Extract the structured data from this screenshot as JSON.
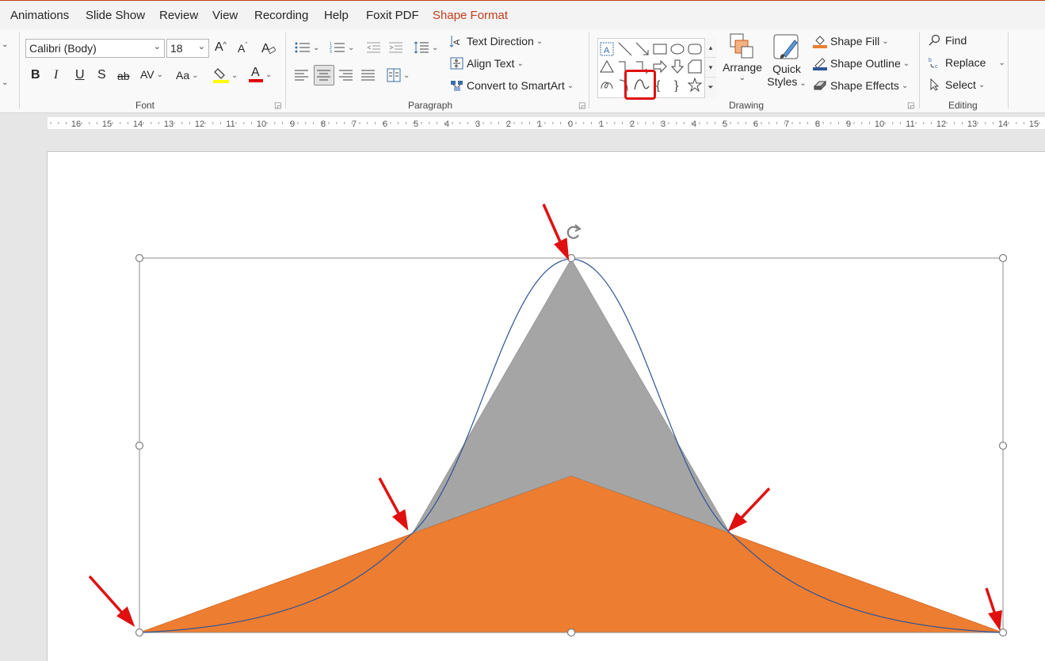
{
  "tabs": [
    {
      "label": "Animations",
      "active": false
    },
    {
      "label": "Slide Show",
      "active": false
    },
    {
      "label": "Review",
      "active": false
    },
    {
      "label": "View",
      "active": false
    },
    {
      "label": "Recording",
      "active": false
    },
    {
      "label": "Help",
      "active": false
    },
    {
      "label": "Foxit PDF",
      "active": false
    },
    {
      "label": "Shape Format",
      "active": true
    }
  ],
  "font": {
    "family": "Calibri (Body)",
    "size": "18",
    "group_label": "Font",
    "buttons": {
      "grow": "A",
      "shrink": "A",
      "bold": "B",
      "italic": "I",
      "underline": "U",
      "shadow": "S",
      "strike": "ab",
      "spacing": "AV",
      "case": "Aa",
      "color": "A"
    }
  },
  "paragraph": {
    "group_label": "Paragraph",
    "text_direction": "Text Direction",
    "align_text": "Align Text",
    "convert_smartart": "Convert to SmartArt"
  },
  "drawing": {
    "group_label": "Drawing",
    "arrange": "Arrange",
    "quick": "Quick",
    "styles": "Styles",
    "shape_fill": "Shape Fill",
    "shape_outline": "Shape Outline",
    "shape_effects": "Shape Effects",
    "fill_color": "#ed7d31"
  },
  "editing": {
    "group_label": "Editing",
    "find": "Find",
    "replace": "Replace",
    "select": "Select"
  },
  "ruler": {
    "labels": [
      "16",
      "15",
      "14",
      "13",
      "12",
      "11",
      "10",
      "9",
      "8",
      "7",
      "6",
      "5",
      "4",
      "3",
      "2",
      "1",
      "0",
      "1",
      "2",
      "3",
      "4",
      "5",
      "6",
      "7",
      "8",
      "9",
      "10",
      "11",
      "12",
      "13",
      "14",
      "15"
    ]
  },
  "colors": {
    "accent": "#c43e1c",
    "orange_shape": "#ed7d31",
    "gray_shape": "#a5a5a5",
    "curve": "#2f5597",
    "arrow": "#e01010",
    "highlight": "#e01010"
  }
}
